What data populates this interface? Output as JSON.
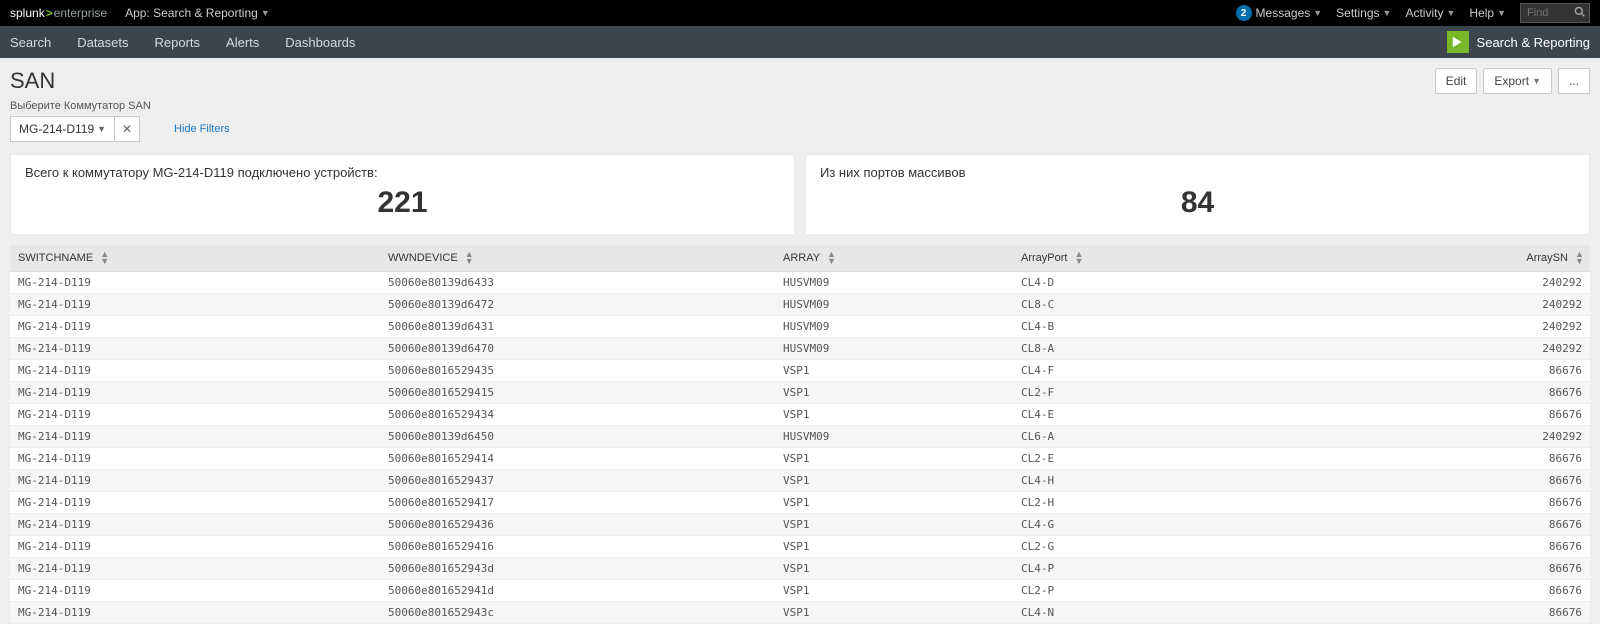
{
  "top": {
    "logo_sp": "splunk",
    "logo_ent": "enterprise",
    "app_label": "App: Search & Reporting",
    "messages": "Messages",
    "messages_count": "2",
    "settings": "Settings",
    "activity": "Activity",
    "help": "Help",
    "find_placeholder": "Find"
  },
  "appnav": {
    "items": [
      "Search",
      "Datasets",
      "Reports",
      "Alerts",
      "Dashboards"
    ],
    "brand": "Search & Reporting"
  },
  "dashboard": {
    "title": "SAN",
    "edit": "Edit",
    "export": "Export",
    "more": "...",
    "filter_label": "Выберите Коммутатор SAN",
    "filter_value": "MG-214-D119",
    "hide_filters": "Hide Filters"
  },
  "panels": {
    "left_title": "Всего к коммутатору MG-214-D119 подключено устройств:",
    "left_value": "221",
    "right_title": "Из них портов массивов",
    "right_value": "84"
  },
  "table": {
    "headers": {
      "switchname": "SWITCHNAME",
      "wwn": "WWNDEVICE",
      "array": "ARRAY",
      "arrayport": "ArrayPort",
      "arraysn": "ArraySN"
    },
    "rows": [
      {
        "s": "MG-214-D119",
        "w": "50060e80139d6433",
        "a": "HUSVM09",
        "p": "CL4-D",
        "n": "240292"
      },
      {
        "s": "MG-214-D119",
        "w": "50060e80139d6472",
        "a": "HUSVM09",
        "p": "CL8-C",
        "n": "240292"
      },
      {
        "s": "MG-214-D119",
        "w": "50060e80139d6431",
        "a": "HUSVM09",
        "p": "CL4-B",
        "n": "240292"
      },
      {
        "s": "MG-214-D119",
        "w": "50060e80139d6470",
        "a": "HUSVM09",
        "p": "CL8-A",
        "n": "240292"
      },
      {
        "s": "MG-214-D119",
        "w": "50060e8016529435",
        "a": "VSP1",
        "p": "CL4-F",
        "n": "86676"
      },
      {
        "s": "MG-214-D119",
        "w": "50060e8016529415",
        "a": "VSP1",
        "p": "CL2-F",
        "n": "86676"
      },
      {
        "s": "MG-214-D119",
        "w": "50060e8016529434",
        "a": "VSP1",
        "p": "CL4-E",
        "n": "86676"
      },
      {
        "s": "MG-214-D119",
        "w": "50060e80139d6450",
        "a": "HUSVM09",
        "p": "CL6-A",
        "n": "240292"
      },
      {
        "s": "MG-214-D119",
        "w": "50060e8016529414",
        "a": "VSP1",
        "p": "CL2-E",
        "n": "86676"
      },
      {
        "s": "MG-214-D119",
        "w": "50060e8016529437",
        "a": "VSP1",
        "p": "CL4-H",
        "n": "86676"
      },
      {
        "s": "MG-214-D119",
        "w": "50060e8016529417",
        "a": "VSP1",
        "p": "CL2-H",
        "n": "86676"
      },
      {
        "s": "MG-214-D119",
        "w": "50060e8016529436",
        "a": "VSP1",
        "p": "CL4-G",
        "n": "86676"
      },
      {
        "s": "MG-214-D119",
        "w": "50060e8016529416",
        "a": "VSP1",
        "p": "CL2-G",
        "n": "86676"
      },
      {
        "s": "MG-214-D119",
        "w": "50060e801652943d",
        "a": "VSP1",
        "p": "CL4-P",
        "n": "86676"
      },
      {
        "s": "MG-214-D119",
        "w": "50060e801652941d",
        "a": "VSP1",
        "p": "CL2-P",
        "n": "86676"
      },
      {
        "s": "MG-214-D119",
        "w": "50060e801652943c",
        "a": "VSP1",
        "p": "CL4-N",
        "n": "86676"
      }
    ]
  }
}
